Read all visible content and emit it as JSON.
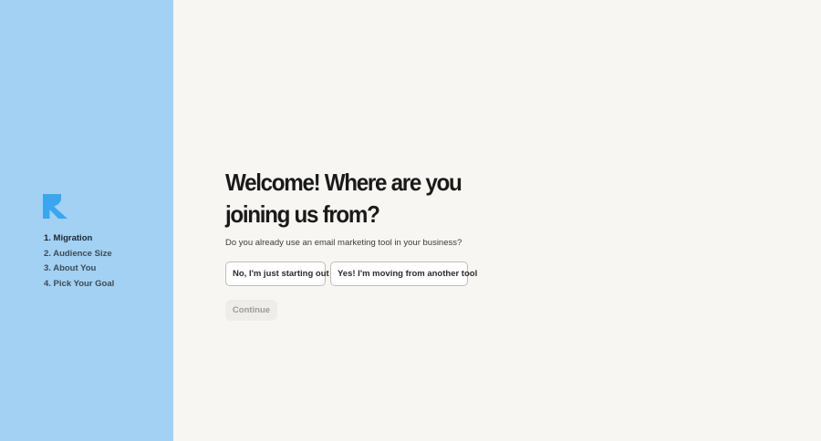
{
  "sidebar": {
    "logo_icon": "klaviyo-k-logo-icon",
    "accent_color": "#3aa6f0",
    "background_color": "#a3d1f3",
    "steps": [
      {
        "label": "1. Migration",
        "active": true
      },
      {
        "label": "2. Audience Size",
        "active": false
      },
      {
        "label": "3. About You",
        "active": false
      },
      {
        "label": "4. Pick Your Goal",
        "active": false
      }
    ]
  },
  "main": {
    "title": "Welcome! Where are you joining us from?",
    "subtitle": "Do you already use an email marketing tool in your business?",
    "options": [
      {
        "label": "No, I'm just starting out"
      },
      {
        "label": "Yes! I'm moving from another tool"
      }
    ],
    "continue_label": "Continue",
    "continue_disabled": true
  }
}
